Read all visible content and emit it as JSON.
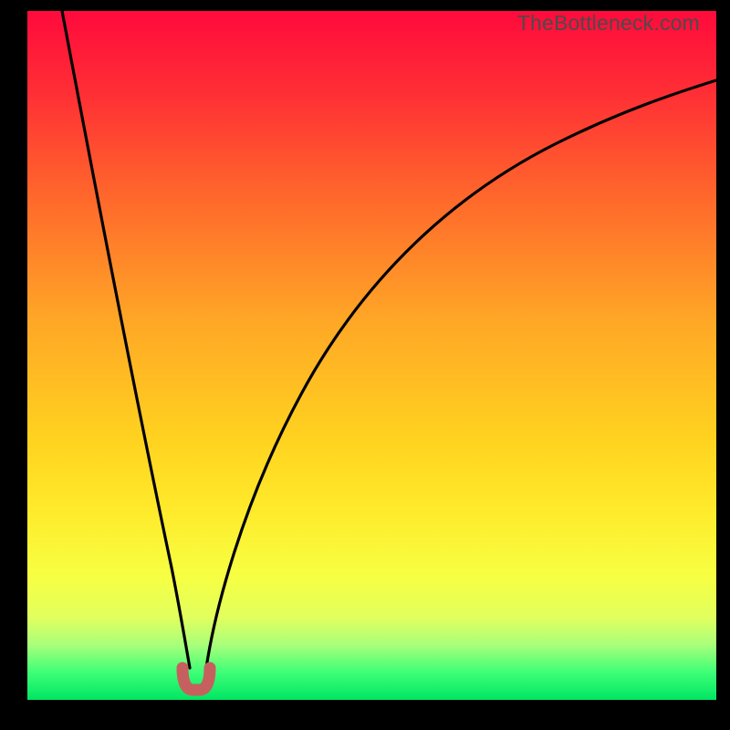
{
  "watermark": "TheBottleneck.com",
  "chart_data": {
    "type": "line",
    "title": "",
    "xlabel": "",
    "ylabel": "",
    "xlim": [
      0,
      100
    ],
    "ylim": [
      0,
      100
    ],
    "series": [
      {
        "name": "bottleneck-curve",
        "x": [
          5,
          8,
          12,
          16,
          19,
          21,
          22.5,
          23.5,
          24.5,
          25.5,
          27,
          30,
          35,
          40,
          47,
          55,
          63,
          72,
          82,
          92,
          100
        ],
        "y": [
          100,
          82,
          58,
          35,
          17,
          7,
          2,
          0,
          0,
          2,
          8,
          20,
          36,
          47,
          58,
          67,
          73,
          79,
          84,
          88,
          91
        ]
      }
    ],
    "marker": {
      "name": "optimal-point",
      "x_range": [
        22.3,
        25.0
      ],
      "y": 0,
      "color": "#c6605e"
    },
    "gradient_meaning": {
      "top": "high bottleneck (red)",
      "bottom": "no bottleneck (green)"
    }
  }
}
